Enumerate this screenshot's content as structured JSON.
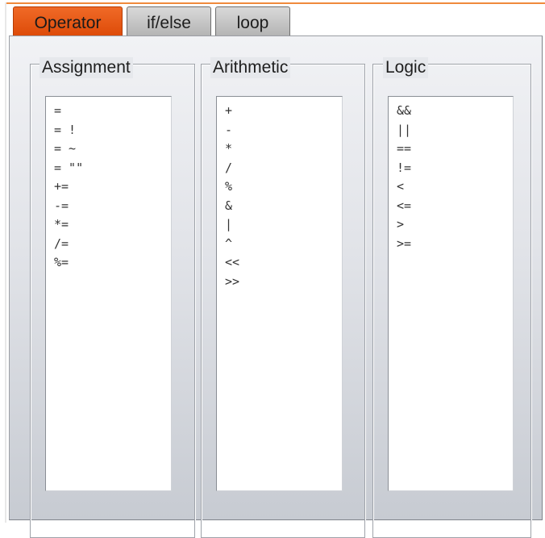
{
  "tabs": [
    {
      "label": "Operator",
      "active": true
    },
    {
      "label": "if/else",
      "active": false
    },
    {
      "label": "loop",
      "active": false
    }
  ],
  "groups": [
    {
      "title": "Assignment",
      "items": [
        "=",
        "= !",
        "= ~",
        "= \"\"",
        "+=",
        "-=",
        "*=",
        "/=",
        "%="
      ]
    },
    {
      "title": "Arithmetic",
      "items": [
        "+",
        "-",
        "*",
        "/",
        "%",
        "&",
        "|",
        "^",
        "<<",
        ">>"
      ]
    },
    {
      "title": "Logic",
      "items": [
        "&&",
        "||",
        "==",
        "!=",
        "<",
        "<=",
        ">",
        ">="
      ]
    }
  ],
  "colors": {
    "active_tab": "#e8541a",
    "inactive_tab": "#c4c4c4",
    "accent_line": "#f08a3c",
    "panel": "#dfe1e6"
  }
}
